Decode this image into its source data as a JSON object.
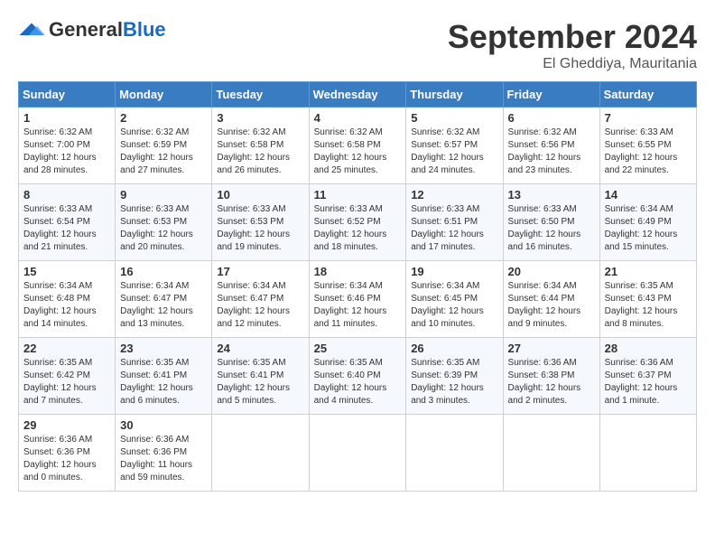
{
  "logo": {
    "general": "General",
    "blue": "Blue"
  },
  "header": {
    "month": "September 2024",
    "location": "El Gheddiya, Mauritania"
  },
  "weekdays": [
    "Sunday",
    "Monday",
    "Tuesday",
    "Wednesday",
    "Thursday",
    "Friday",
    "Saturday"
  ],
  "weeks": [
    [
      {
        "day": "1",
        "info": "Sunrise: 6:32 AM\nSunset: 7:00 PM\nDaylight: 12 hours\nand 28 minutes."
      },
      {
        "day": "2",
        "info": "Sunrise: 6:32 AM\nSunset: 6:59 PM\nDaylight: 12 hours\nand 27 minutes."
      },
      {
        "day": "3",
        "info": "Sunrise: 6:32 AM\nSunset: 6:58 PM\nDaylight: 12 hours\nand 26 minutes."
      },
      {
        "day": "4",
        "info": "Sunrise: 6:32 AM\nSunset: 6:58 PM\nDaylight: 12 hours\nand 25 minutes."
      },
      {
        "day": "5",
        "info": "Sunrise: 6:32 AM\nSunset: 6:57 PM\nDaylight: 12 hours\nand 24 minutes."
      },
      {
        "day": "6",
        "info": "Sunrise: 6:32 AM\nSunset: 6:56 PM\nDaylight: 12 hours\nand 23 minutes."
      },
      {
        "day": "7",
        "info": "Sunrise: 6:33 AM\nSunset: 6:55 PM\nDaylight: 12 hours\nand 22 minutes."
      }
    ],
    [
      {
        "day": "8",
        "info": "Sunrise: 6:33 AM\nSunset: 6:54 PM\nDaylight: 12 hours\nand 21 minutes."
      },
      {
        "day": "9",
        "info": "Sunrise: 6:33 AM\nSunset: 6:53 PM\nDaylight: 12 hours\nand 20 minutes."
      },
      {
        "day": "10",
        "info": "Sunrise: 6:33 AM\nSunset: 6:53 PM\nDaylight: 12 hours\nand 19 minutes."
      },
      {
        "day": "11",
        "info": "Sunrise: 6:33 AM\nSunset: 6:52 PM\nDaylight: 12 hours\nand 18 minutes."
      },
      {
        "day": "12",
        "info": "Sunrise: 6:33 AM\nSunset: 6:51 PM\nDaylight: 12 hours\nand 17 minutes."
      },
      {
        "day": "13",
        "info": "Sunrise: 6:33 AM\nSunset: 6:50 PM\nDaylight: 12 hours\nand 16 minutes."
      },
      {
        "day": "14",
        "info": "Sunrise: 6:34 AM\nSunset: 6:49 PM\nDaylight: 12 hours\nand 15 minutes."
      }
    ],
    [
      {
        "day": "15",
        "info": "Sunrise: 6:34 AM\nSunset: 6:48 PM\nDaylight: 12 hours\nand 14 minutes."
      },
      {
        "day": "16",
        "info": "Sunrise: 6:34 AM\nSunset: 6:47 PM\nDaylight: 12 hours\nand 13 minutes."
      },
      {
        "day": "17",
        "info": "Sunrise: 6:34 AM\nSunset: 6:47 PM\nDaylight: 12 hours\nand 12 minutes."
      },
      {
        "day": "18",
        "info": "Sunrise: 6:34 AM\nSunset: 6:46 PM\nDaylight: 12 hours\nand 11 minutes."
      },
      {
        "day": "19",
        "info": "Sunrise: 6:34 AM\nSunset: 6:45 PM\nDaylight: 12 hours\nand 10 minutes."
      },
      {
        "day": "20",
        "info": "Sunrise: 6:34 AM\nSunset: 6:44 PM\nDaylight: 12 hours\nand 9 minutes."
      },
      {
        "day": "21",
        "info": "Sunrise: 6:35 AM\nSunset: 6:43 PM\nDaylight: 12 hours\nand 8 minutes."
      }
    ],
    [
      {
        "day": "22",
        "info": "Sunrise: 6:35 AM\nSunset: 6:42 PM\nDaylight: 12 hours\nand 7 minutes."
      },
      {
        "day": "23",
        "info": "Sunrise: 6:35 AM\nSunset: 6:41 PM\nDaylight: 12 hours\nand 6 minutes."
      },
      {
        "day": "24",
        "info": "Sunrise: 6:35 AM\nSunset: 6:41 PM\nDaylight: 12 hours\nand 5 minutes."
      },
      {
        "day": "25",
        "info": "Sunrise: 6:35 AM\nSunset: 6:40 PM\nDaylight: 12 hours\nand 4 minutes."
      },
      {
        "day": "26",
        "info": "Sunrise: 6:35 AM\nSunset: 6:39 PM\nDaylight: 12 hours\nand 3 minutes."
      },
      {
        "day": "27",
        "info": "Sunrise: 6:36 AM\nSunset: 6:38 PM\nDaylight: 12 hours\nand 2 minutes."
      },
      {
        "day": "28",
        "info": "Sunrise: 6:36 AM\nSunset: 6:37 PM\nDaylight: 12 hours\nand 1 minute."
      }
    ],
    [
      {
        "day": "29",
        "info": "Sunrise: 6:36 AM\nSunset: 6:36 PM\nDaylight: 12 hours\nand 0 minutes."
      },
      {
        "day": "30",
        "info": "Sunrise: 6:36 AM\nSunset: 6:36 PM\nDaylight: 11 hours\nand 59 minutes."
      },
      null,
      null,
      null,
      null,
      null
    ]
  ]
}
